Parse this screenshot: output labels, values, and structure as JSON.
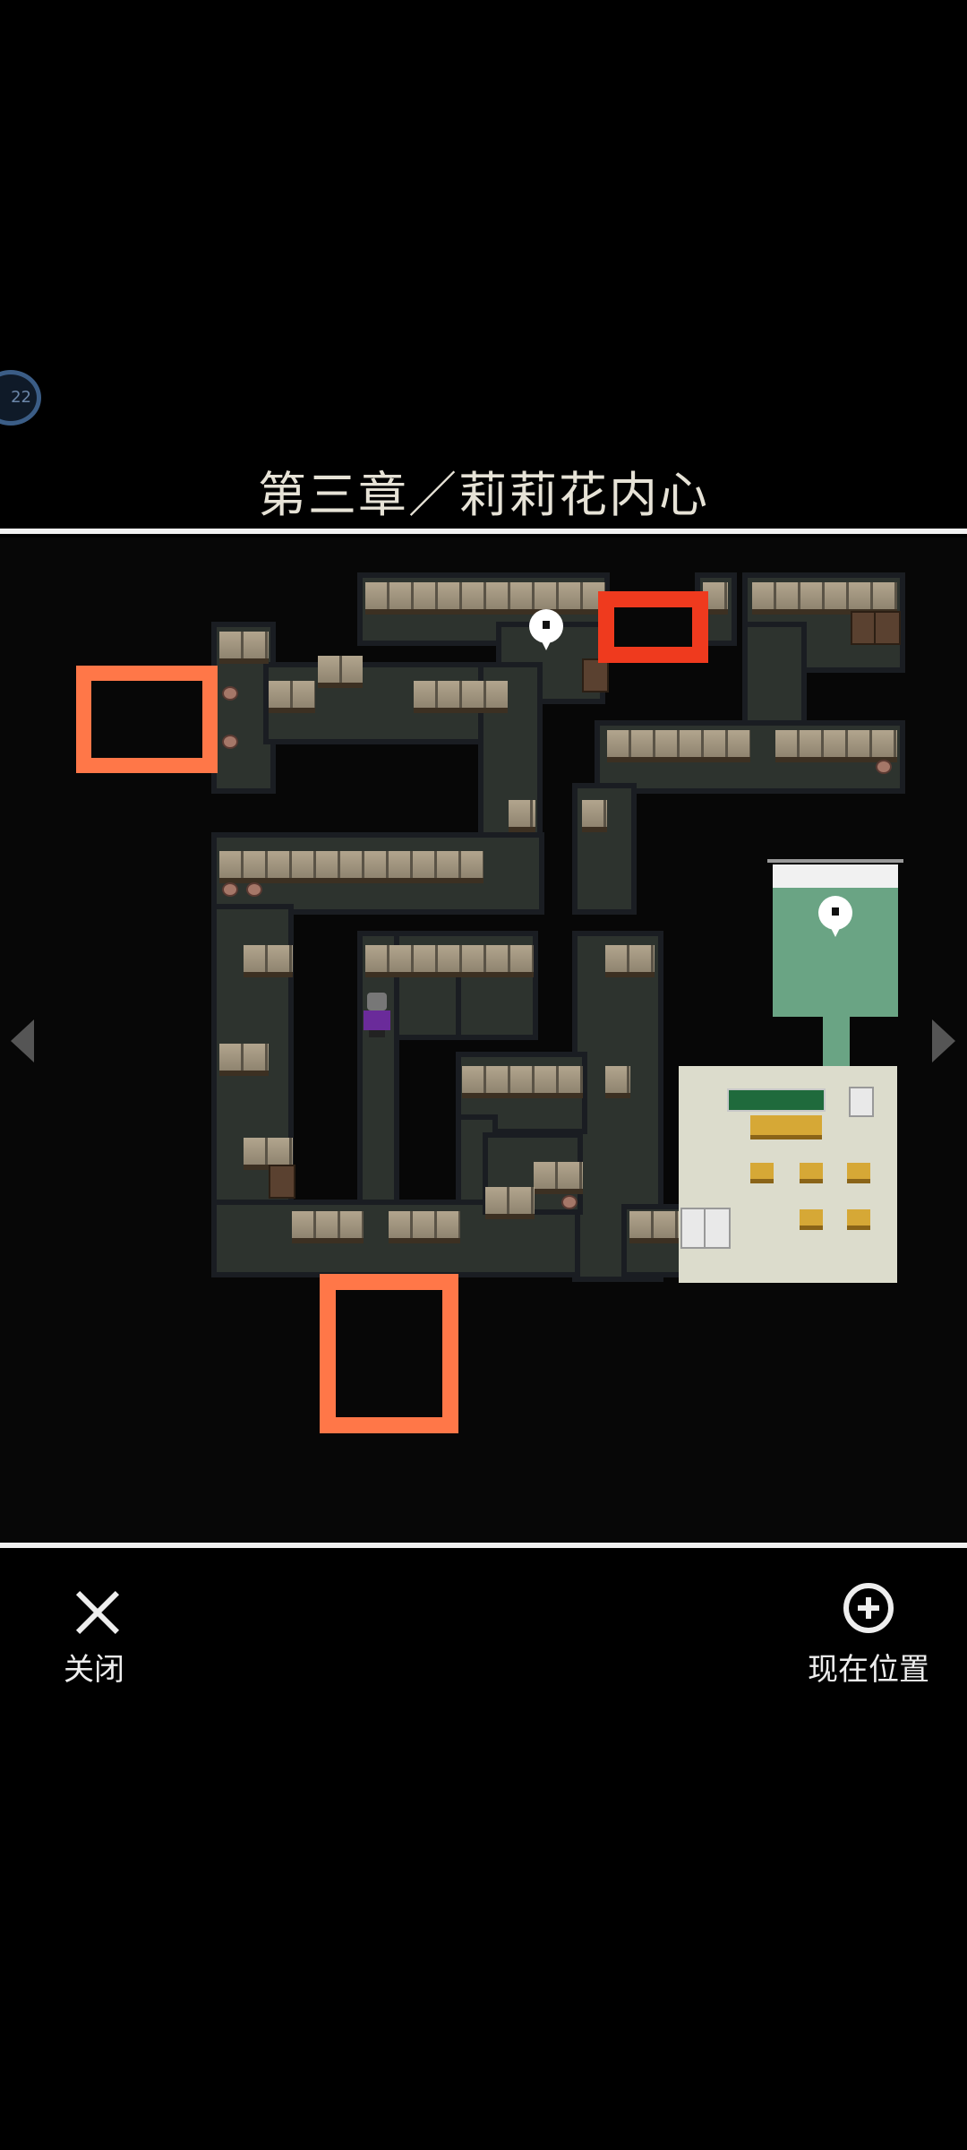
{
  "header": {
    "badge_text": "22",
    "title": "第三章／莉莉花内心"
  },
  "map": {
    "icons": {
      "left_arrow": "chevron-left-icon",
      "right_arrow": "chevron-right-icon",
      "markers": "map-pin-icon",
      "player": "player-sprite"
    },
    "colors": {
      "highlight_red": "#ef3a1e",
      "highlight_orange": "#ff7748",
      "floor": "#2d332e",
      "room_green": "#6aa484"
    }
  },
  "footer": {
    "close_label": "关闭",
    "locate_label": "现在位置"
  }
}
